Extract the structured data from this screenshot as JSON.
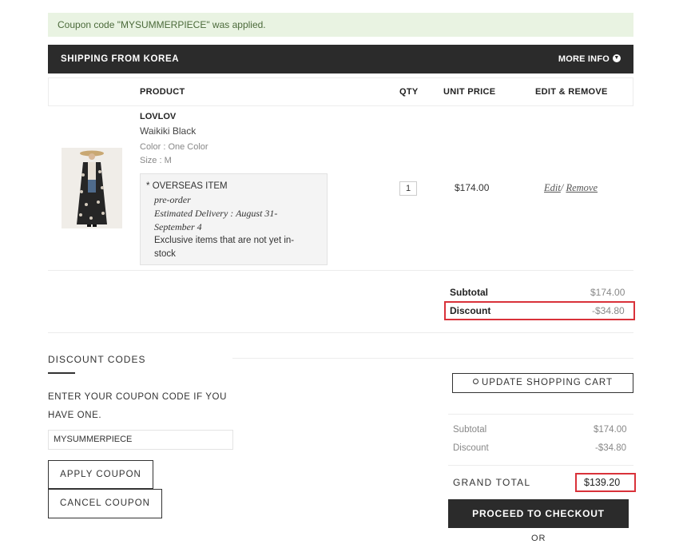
{
  "notice": {
    "text": "Coupon code \"MYSUMMERPIECE\" was applied."
  },
  "shipping_bar": {
    "title": "SHIPPING FROM KOREA",
    "more_info": "MORE INFO",
    "more_icon": "chevron-down-circle-icon"
  },
  "table_head": {
    "product": "PRODUCT",
    "qty": "QTY",
    "unit_price": "UNIT PRICE",
    "edit_remove": "EDIT & REMOVE"
  },
  "item": {
    "brand": "LOVLOV",
    "name": "Waikiki Black",
    "color": "Color : One Color",
    "size": "Size : M",
    "overseas": {
      "marker": "*",
      "heading": "OVERSEAS ITEM",
      "preorder": "pre-order",
      "delivery_line1": "Estimated Delivery : August 31-",
      "delivery_line2": "September 4",
      "exclusive_line1": "Exclusive items that are not yet in-",
      "exclusive_line2": "stock"
    },
    "qty": "1",
    "unit_price": "$174.00",
    "edit": "Edit",
    "separator": "/",
    "remove": "Remove"
  },
  "cart_totals": {
    "subtotal_label": "Subtotal",
    "subtotal_value": "$174.00",
    "discount_label": "Discount",
    "discount_value": "-$34.80"
  },
  "discount_section": {
    "title": "DISCOUNT CODES",
    "hint_line1": "ENTER YOUR COUPON CODE IF YOU",
    "hint_line2": "HAVE ONE.",
    "coupon_value": "MYSUMMERPIECE",
    "apply_label": "APPLY COUPON",
    "cancel_label": "CANCEL COUPON"
  },
  "summary": {
    "update_label": "UPDATE SHOPPING CART",
    "subtotal_label": "Subtotal",
    "subtotal_value": "$174.00",
    "discount_label": "Discount",
    "discount_value": "-$34.80",
    "grand_total_label": "GRAND TOTAL",
    "grand_total_value": "$139.20",
    "checkout_label": "PROCEED TO CHECKOUT",
    "or_label": "OR"
  },
  "colors": {
    "dark": "#2b2b2b",
    "highlight_red": "#d9323a",
    "notice_bg": "#e9f3e2"
  }
}
